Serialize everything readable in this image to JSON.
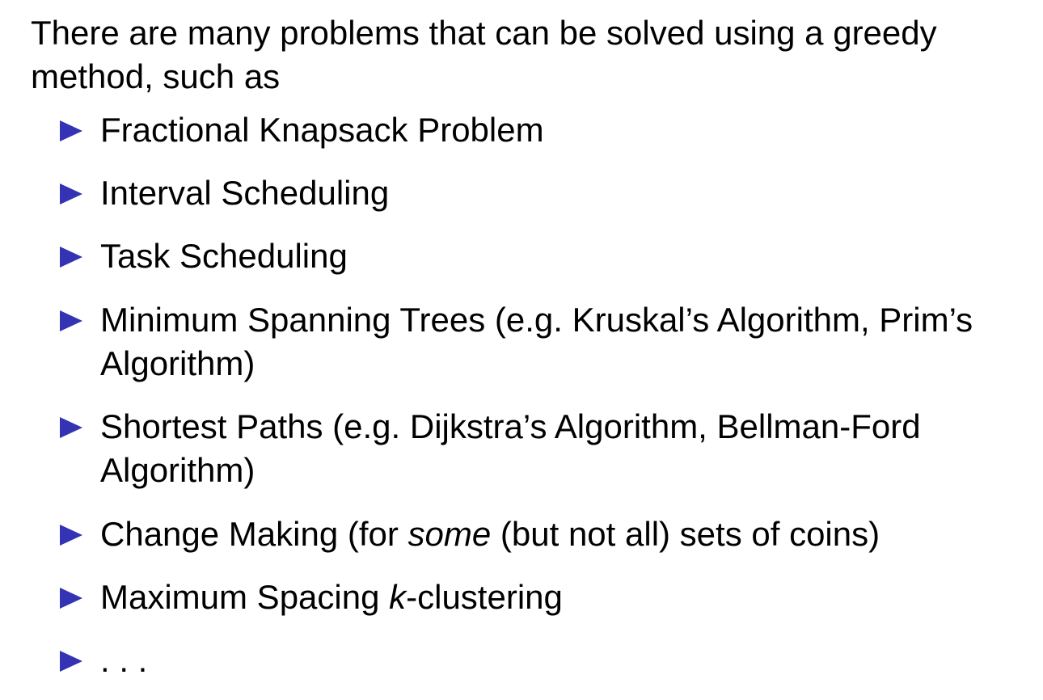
{
  "slide": {
    "intro": "There are many problems that can be solved using a greedy method, such as",
    "bullet_color": "#3333b3",
    "items": [
      {
        "segments": [
          {
            "text": "Fractional Knapsack Problem",
            "italic": false
          }
        ]
      },
      {
        "segments": [
          {
            "text": "Interval Scheduling",
            "italic": false
          }
        ]
      },
      {
        "segments": [
          {
            "text": "Task Scheduling",
            "italic": false
          }
        ]
      },
      {
        "segments": [
          {
            "text": "Minimum Spanning Trees (e.g. Kruskal’s Algorithm, Prim’s Algorithm)",
            "italic": false
          }
        ]
      },
      {
        "segments": [
          {
            "text": "Shortest Paths (e.g. Dijkstra’s Algorithm, Bellman-Ford Algorithm)",
            "italic": false
          }
        ]
      },
      {
        "segments": [
          {
            "text": "Change Making (for ",
            "italic": false
          },
          {
            "text": "some",
            "italic": true
          },
          {
            "text": " (but not all) sets of coins)",
            "italic": false
          }
        ]
      },
      {
        "segments": [
          {
            "text": "Maximum Spacing ",
            "italic": false
          },
          {
            "text": "k",
            "italic": true
          },
          {
            "text": "-clustering",
            "italic": false
          }
        ]
      },
      {
        "segments": [
          {
            "text": ". . .",
            "italic": false
          }
        ]
      }
    ]
  }
}
